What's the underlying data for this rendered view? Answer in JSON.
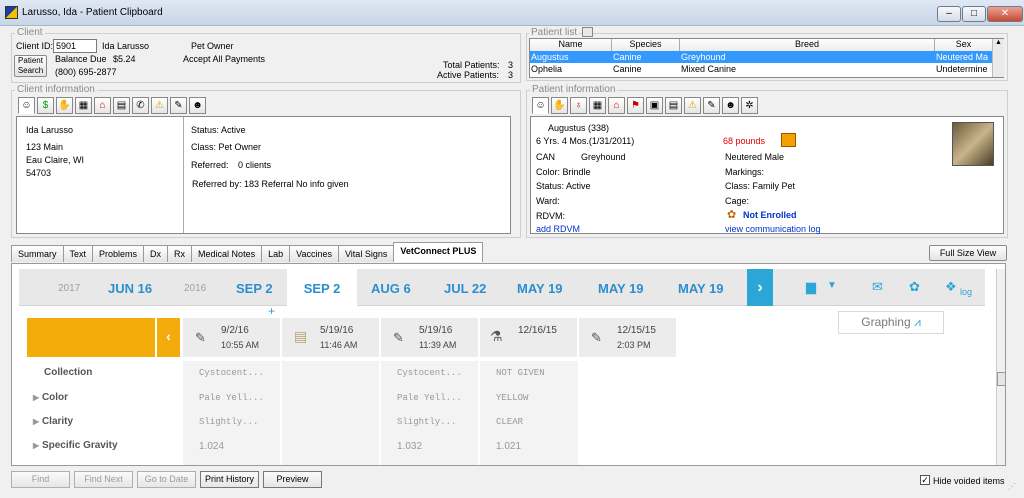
{
  "window": {
    "title": "Larusso, Ida - Patient Clipboard"
  },
  "client": {
    "group_label": "Client",
    "client_id_label": "Client ID:",
    "client_id": "5901",
    "name": "Ida Larusso",
    "owner_type": "Pet Owner",
    "patient_search_label": "Patient Search",
    "balance_label": "Balance Due",
    "balance": "$5.24",
    "payment_policy": "Accept All Payments",
    "phone": "(800) 695-2877",
    "total_patients_label": "Total Patients:",
    "total_patients": "3",
    "active_patients_label": "Active Patients:",
    "active_patients": "3"
  },
  "patient_list": {
    "label": "Patient list",
    "headers": [
      "Name",
      "Species",
      "Breed",
      "Sex"
    ],
    "rows": [
      [
        "Augustus",
        "Canine",
        "Greyhound",
        "Neutered Ma"
      ],
      [
        "Ophelia",
        "Canine",
        "Mixed Canine",
        "Undetermine"
      ]
    ]
  },
  "client_info": {
    "label": "Client information",
    "name": "Ida Larusso",
    "address1": "123 Main",
    "city": "Eau Claire, WI",
    "zip": "54703",
    "status": "Status: Active",
    "class": "Class:  Pet Owner",
    "referred_label": "Referred:",
    "referred": "0 clients",
    "referred_by": "Referred by: 183  Referral No info given"
  },
  "patient_info": {
    "label": "Patient information",
    "name": "Augustus (338)",
    "age": "6 Yrs. 4 Mos.(1/31/2011)",
    "weight": "68 pounds",
    "species": "CAN",
    "breed": "Greyhound",
    "sex": "Neutered Male",
    "color": "Color:  Brindle",
    "markings": "Markings:",
    "status": "Status:  Active",
    "class": "Class:  Family Pet",
    "ward": "Ward:",
    "cage": "Cage:",
    "rdvm": "RDVM:",
    "enrollment": "Not Enrolled",
    "add_rdvm": "add RDVM",
    "view_log": "view communication log"
  },
  "tabs": [
    "Summary",
    "Text",
    "Problems",
    "Dx",
    "Rx",
    "Medical Notes",
    "Lab",
    "Vaccines",
    "Vital Signs",
    "VetConnect PLUS"
  ],
  "full_size_view": "Full Size View",
  "vetconnect": {
    "dates": [
      {
        "label": "2017",
        "kind": "year"
      },
      {
        "label": "JUN 16",
        "kind": "date"
      },
      {
        "label": "2016",
        "kind": "year"
      },
      {
        "label": "SEP 2",
        "kind": "date"
      },
      {
        "label": "SEP 2",
        "kind": "selected"
      },
      {
        "label": "AUG 6",
        "kind": "date"
      },
      {
        "label": "JUL 22",
        "kind": "date"
      },
      {
        "label": "MAY 19",
        "kind": "date"
      },
      {
        "label": "MAY 19",
        "kind": "date"
      },
      {
        "label": "MAY 19",
        "kind": "date"
      }
    ],
    "log_label": "log",
    "graphing_label": "Graphing",
    "columns": [
      {
        "date": "9/2/16",
        "time": "10:55 AM",
        "icon": "syringe-icon"
      },
      {
        "date": "5/19/16",
        "time": "11:46 AM",
        "icon": "document-icon"
      },
      {
        "date": "5/19/16",
        "time": "11:39 AM",
        "icon": "syringe-icon"
      },
      {
        "date": "12/16/15",
        "time": "",
        "icon": "flask-icon"
      },
      {
        "date": "12/15/15",
        "time": "2:03 PM",
        "icon": "syringe-icon"
      }
    ],
    "rows": [
      {
        "label": "Collection",
        "expand": false,
        "values": [
          "Cystocent...",
          "",
          "Cystocent...",
          "NOT GIVEN"
        ]
      },
      {
        "label": "Color",
        "expand": true,
        "values": [
          "Pale Yell...",
          "",
          "Pale Yell...",
          "YELLOW"
        ]
      },
      {
        "label": "Clarity",
        "expand": true,
        "values": [
          "Slightly...",
          "",
          "Slightly...",
          "CLEAR"
        ]
      },
      {
        "label": "Specific Gravity",
        "expand": true,
        "values": [
          "1.024",
          "",
          "1.032",
          "1.021"
        ]
      }
    ]
  },
  "bottom": {
    "find": "Find",
    "find_next": "Find Next",
    "go_to_date": "Go to Date",
    "print_history": "Print History",
    "preview": "Preview",
    "hide_voided": "Hide voided items"
  }
}
